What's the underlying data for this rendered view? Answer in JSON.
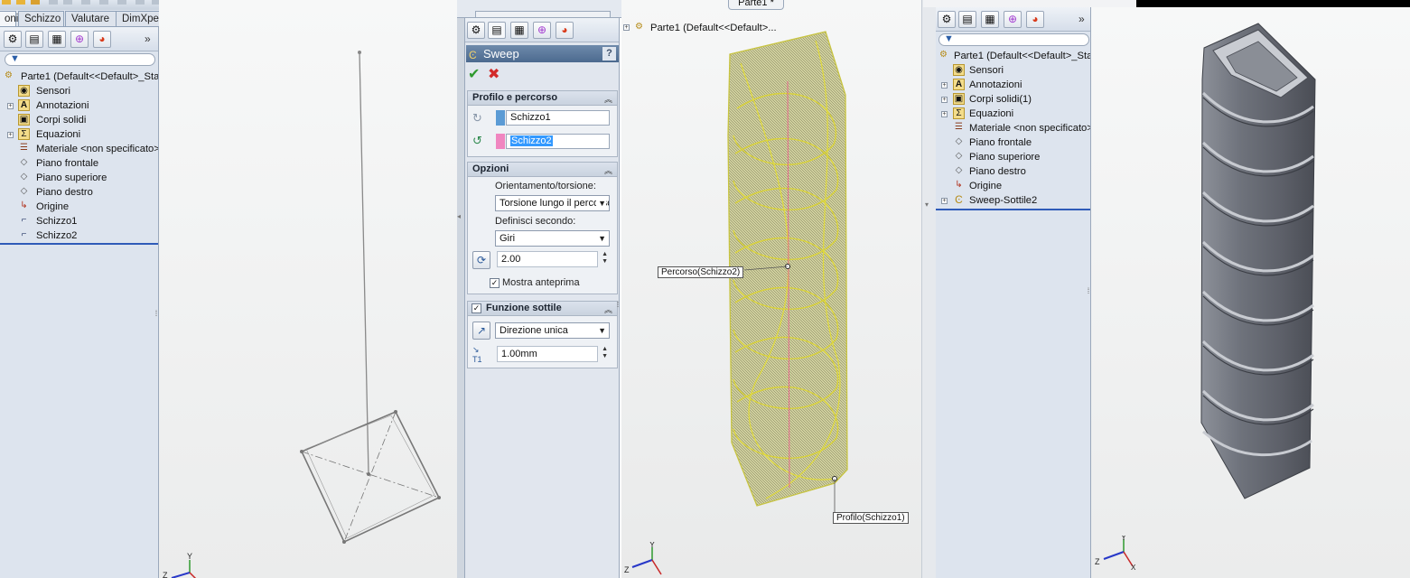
{
  "panel1": {
    "tabs": [
      "oni",
      "Schizzo",
      "Valutare",
      "DimXpert"
    ],
    "tree_root": "Parte1  (Default<<Default>_Stat",
    "tree_items": [
      "Sensori",
      "Annotazioni",
      "Corpi solidi",
      "Equazioni",
      "Materiale <non specificato>",
      "Piano frontale",
      "Piano superiore",
      "Piano destro",
      "Origine",
      "Schizzo1",
      "Schizzo2"
    ],
    "panel_expand": "»"
  },
  "panel2": {
    "feature_title": "Sweep",
    "help": "?",
    "ok_icon": "check-icon",
    "cancel_icon": "x-icon",
    "profile_group": {
      "title": "Profilo e percorso",
      "profile_value": "Schizzo1",
      "path_value": "Schizzo2",
      "profile_color": "#5b9bd5",
      "path_color": "#f086c0"
    },
    "options_group": {
      "title": "Opzioni",
      "orient_label": "Orientamento/torsione:",
      "orient_value": "Torsione lungo il percorso",
      "define_label": "Definisci secondo:",
      "define_value": "Giri",
      "turns_value": "2.00",
      "preview_label": "Mostra anteprima",
      "preview_checked": true
    },
    "thin_group": {
      "title": "Funzione sottile",
      "enabled": true,
      "direction_value": "Direzione unica",
      "thickness_value": "1.00mm"
    }
  },
  "panel3": {
    "window_title": "Parte1 *",
    "tree_root": "Parte1  (Default<<Default>...",
    "path_callout": "Percorso(Schizzo2)",
    "profile_callout": "Profilo(Schizzo1)"
  },
  "panel4": {
    "tree_root": "Parte1  (Default<<Default>_Stat",
    "tree_items": [
      "Sensori",
      "Annotazioni",
      "Corpi solidi(1)",
      "Equazioni",
      "Materiale <non specificato>",
      "Piano frontale",
      "Piano superiore",
      "Piano destro",
      "Origine",
      "Sweep-Sottile2"
    ],
    "panel_expand": "»"
  },
  "triad_labels": {
    "x": "X",
    "y": "Y",
    "z": "Z"
  }
}
